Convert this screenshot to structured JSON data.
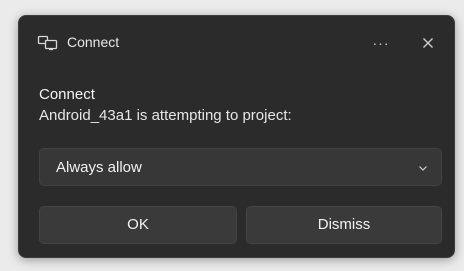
{
  "window": {
    "title": "Connect",
    "app_icon": "project-screen-icon",
    "more_icon": "more-options-icon",
    "more_label": "···",
    "close_icon": "close-icon"
  },
  "content": {
    "heading": "Connect",
    "message": "Android_43a1 is attempting to project:"
  },
  "permission_select": {
    "selected": "Always allow",
    "chevron_icon": "chevron-down-icon"
  },
  "buttons": {
    "ok_label": "OK",
    "dismiss_label": "Dismiss"
  },
  "colors": {
    "dialog_background": "#2b2b2b",
    "control_background": "#373737",
    "text": "#f2f2f2"
  }
}
